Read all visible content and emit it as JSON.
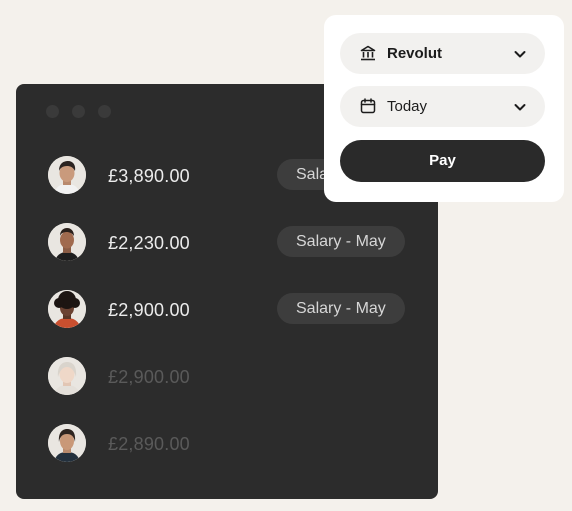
{
  "payments": [
    {
      "amount": "£3,890.00",
      "badge": "Salary - May",
      "dimmed": false
    },
    {
      "amount": "£2,230.00",
      "badge": "Salary - May",
      "dimmed": false
    },
    {
      "amount": "£2,900.00",
      "badge": "Salary - May",
      "dimmed": false
    },
    {
      "amount": "£2,900.00",
      "badge": "",
      "dimmed": true
    },
    {
      "amount": "£2,890.00",
      "badge": "",
      "dimmed": true
    }
  ],
  "pay_panel": {
    "account": {
      "label": "Revolut",
      "icon": "bank-icon"
    },
    "date": {
      "label": "Today",
      "icon": "calendar-icon"
    },
    "pay_button": "Pay"
  },
  "colors": {
    "background": "#f4f1ec",
    "dark_panel": "#2c2c2c",
    "badge": "#3d3d3d",
    "pay_button": "#2a2a2a"
  }
}
